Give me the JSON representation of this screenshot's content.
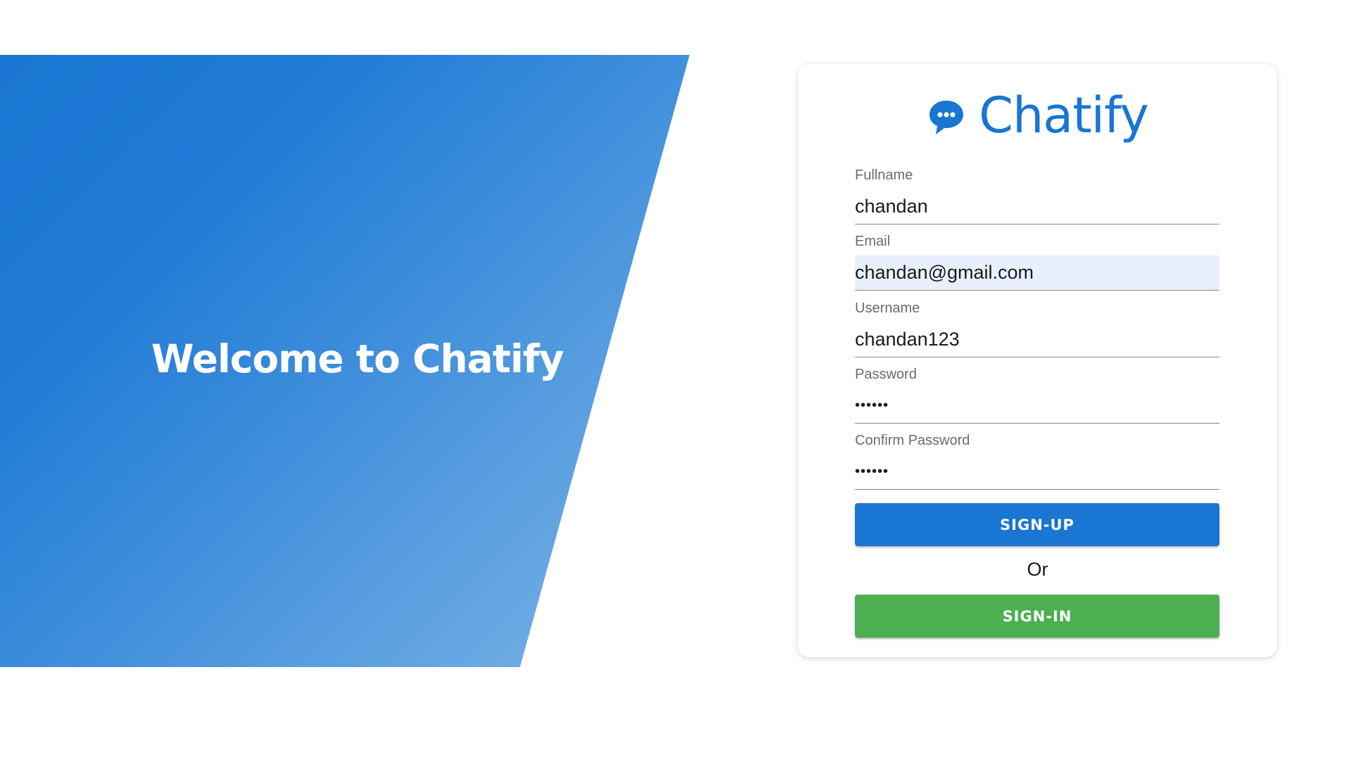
{
  "hero": {
    "title": "Welcome to Chatify"
  },
  "brand": {
    "name": "Chatify",
    "icon": "chat-bubble-icon",
    "color": "#1976d2"
  },
  "form": {
    "fields": [
      {
        "label": "Fullname",
        "value": "chandan"
      },
      {
        "label": "Email",
        "value": "chandan@gmail.com"
      },
      {
        "label": "Username",
        "value": "chandan123"
      },
      {
        "label": "Password",
        "value": "••••••"
      },
      {
        "label": "Confirm Password",
        "value": "••••••"
      }
    ],
    "signup_label": "SIGN-UP",
    "or_text": "Or",
    "signin_label": "SIGN-IN"
  },
  "colors": {
    "primary": "#1976d2",
    "success": "#4caf50",
    "autofill": "#e8f0fe"
  }
}
